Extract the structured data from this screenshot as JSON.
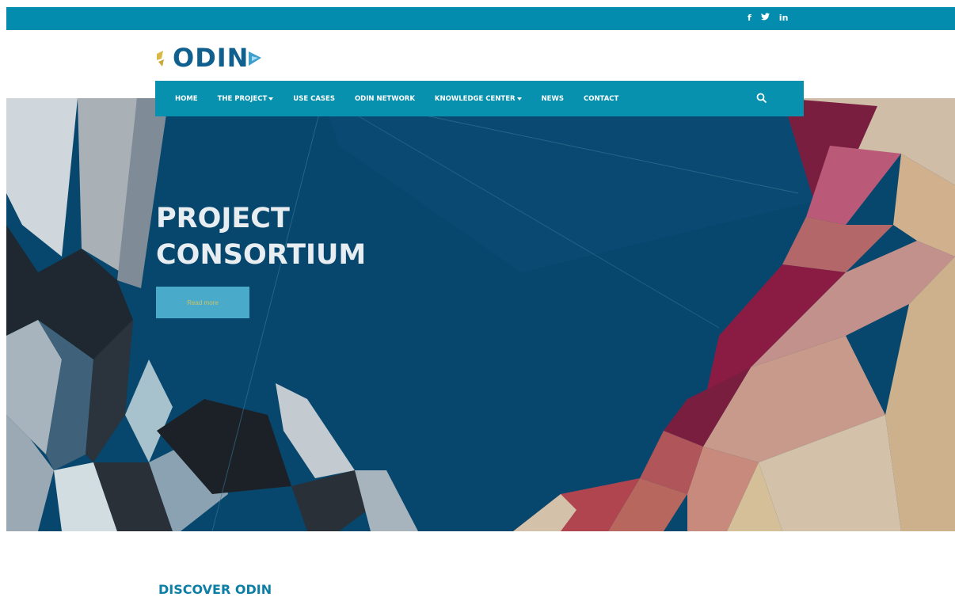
{
  "social": {
    "facebook": "f",
    "twitter": "🐦",
    "linkedin": "in",
    "icons": [
      "facebook-icon",
      "twitter-icon",
      "linkedin-icon"
    ]
  },
  "logo": {
    "text": "ODIN"
  },
  "nav": {
    "items": [
      {
        "label": "HOME",
        "dropdown": false
      },
      {
        "label": "THE PROJECT",
        "dropdown": true
      },
      {
        "label": "USE CASES",
        "dropdown": false
      },
      {
        "label": "ODIN NETWORK",
        "dropdown": false
      },
      {
        "label": "KNOWLEDGE CENTER",
        "dropdown": true
      },
      {
        "label": "NEWS",
        "dropdown": false
      },
      {
        "label": "CONTACT",
        "dropdown": false
      }
    ],
    "search_icon": "search-icon"
  },
  "hero": {
    "title_line1": "PROJECT",
    "title_line2": "CONSORTIUM",
    "button_label": "Read more"
  },
  "section": {
    "heading": "DISCOVER ODIN"
  },
  "colors": {
    "topbar": "#038cae",
    "navbar": "#0891ae",
    "hero_bg": "#07476d",
    "accent": "#0d7ea6"
  }
}
